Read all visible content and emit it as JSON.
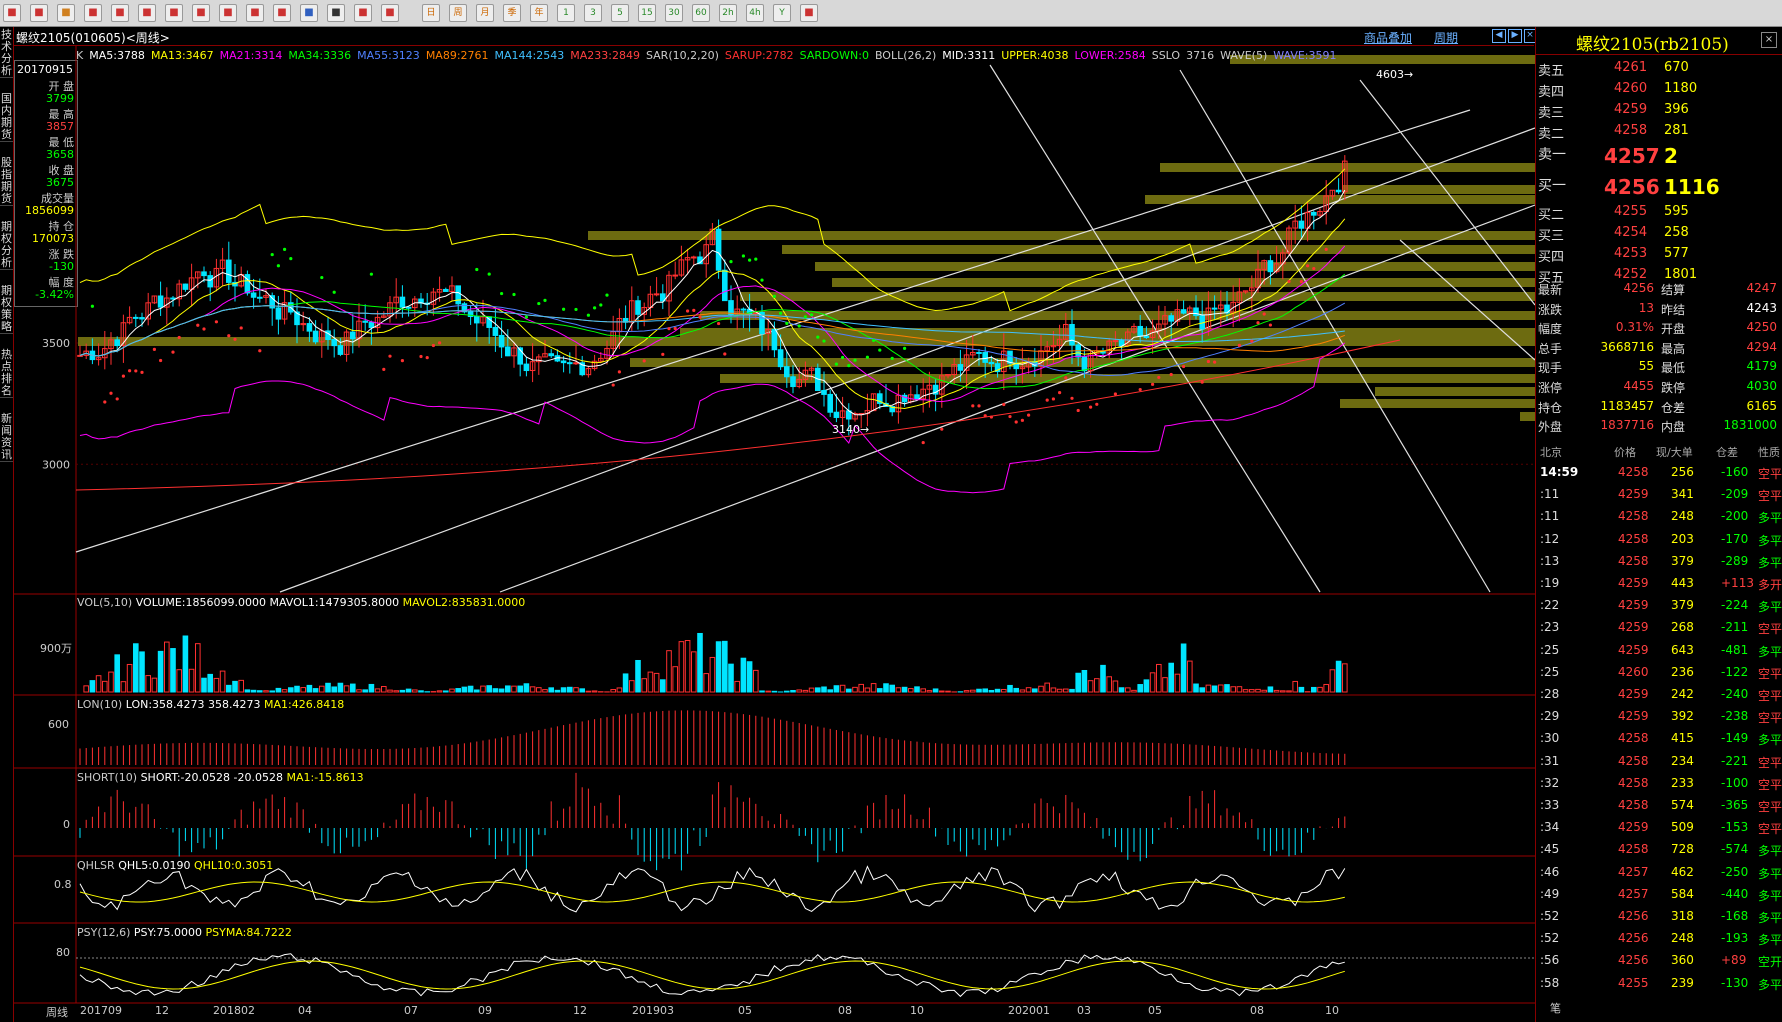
{
  "toolbar": {
    "icons": [
      "home-icon",
      "back-icon",
      "page-icon",
      "news-icon",
      "folder-icon",
      "search-icon",
      "search2-icon",
      "window-icon",
      "pen-icon",
      "draw-icon",
      "filter-icon",
      "edit-icon",
      "list-icon",
      "chart-icon",
      "kline-icon",
      "day-icon",
      "week-icon",
      "month-icon",
      "season-icon",
      "year-icon",
      "m1-icon",
      "m3-icon",
      "m5-icon",
      "m15-icon",
      "m30-icon",
      "m60-icon",
      "custom-icon",
      "calc-icon",
      "x-icon",
      "calendar-icon"
    ],
    "labels": [
      "",
      "",
      "",
      "",
      "",
      "",
      "",
      "",
      "",
      "",
      "",
      "",
      "",
      "",
      "",
      "日",
      "周",
      "月",
      "季",
      "年",
      "1",
      "3",
      "5",
      "15",
      "30",
      "60",
      "2h",
      "4h",
      "Y",
      ""
    ]
  },
  "title": {
    "contract": "螺纹2105(010605)<周线>",
    "overlay": "商品叠加",
    "period": "周期"
  },
  "left_tabs": [
    "技术分析",
    "国内期货",
    "股指期货",
    "期权分析",
    "期权策略",
    "热点排名",
    "新闻资讯"
  ],
  "ohlc": {
    "date": "20170915",
    "open_label": "开  盘",
    "open": "3799",
    "high_label": "最  高",
    "high": "3857",
    "low_label": "最  低",
    "low": "3658",
    "close_label": "收  盘",
    "close": "3675",
    "vol_label": "成交量",
    "vol": "1856099",
    "oi_label": "持  仓",
    "oi": "170073",
    "chg_label": "涨  跌",
    "chg": "-130",
    "pct_label": "幅  度",
    "pct": "-3.42%"
  },
  "main_indicators": [
    {
      "text": "K",
      "color": "#cccccc"
    },
    {
      "text": "MA5:3788",
      "color": "#ffffff"
    },
    {
      "text": "MA13:3467",
      "color": "#ffff00"
    },
    {
      "text": "MA21:3314",
      "color": "#ff00ff"
    },
    {
      "text": "MA34:3336",
      "color": "#00ff00"
    },
    {
      "text": "MA55:3123",
      "color": "#5080ff"
    },
    {
      "text": "MA89:2761",
      "color": "#ff8000"
    },
    {
      "text": "MA144:2543",
      "color": "#40c0ff"
    },
    {
      "text": "MA233:2849",
      "color": "#ff4040"
    },
    {
      "text": "SAR(10,2,20)",
      "color": "#cccccc"
    },
    {
      "text": "SARUP:2782",
      "color": "#ff3030"
    },
    {
      "text": "SARDOWN:0",
      "color": "#00ff00"
    },
    {
      "text": "BOLL(26,2)",
      "color": "#cccccc"
    },
    {
      "text": "MID:3311",
      "color": "#ffffff"
    },
    {
      "text": "UPPER:4038",
      "color": "#ffff00"
    },
    {
      "text": "LOWER:2584",
      "color": "#ff00ff"
    },
    {
      "text": "SSLO",
      "color": "#cccccc"
    },
    {
      "text": "3716",
      "color": "#cccccc"
    },
    {
      "text": "WAVE(5)",
      "color": "#cccccc"
    },
    {
      "text": "WAVE:3591",
      "color": "#8080ff"
    }
  ],
  "main_axis": [
    "3500",
    "3000"
  ],
  "annotations": {
    "high": "4603→",
    "low": "3140→"
  },
  "vol_panel": {
    "name": "VOL(5,10)",
    "t1": "VOLUME:1856099.0000",
    "t2": "MAVOL1:1479305.8000",
    "t3": "MAVOL2:835831.0000",
    "axis": "900万"
  },
  "lon_panel": {
    "name": "LON(10)",
    "t1": "LON:358.4273",
    "t2": "358.4273",
    "t3": "MA1:426.8418",
    "axis": "600"
  },
  "short_panel": {
    "name": "SHORT(10)",
    "t1": "SHORT:-20.0528",
    "t2": "-20.0528",
    "t3": "MA1:-15.8613",
    "axis": "0"
  },
  "qhlsr_panel": {
    "name": "QHLSR",
    "t1": "QHL5:0.0190",
    "t2": "QHL10:0.3051",
    "axis": "0.8"
  },
  "psy_panel": {
    "name": "PSY(12,6)",
    "t1": "PSY:75.0000",
    "t2": "PSYMA:84.7222",
    "axis": "80"
  },
  "x_axis": [
    "周线",
    "201709",
    "12",
    "201802",
    "04",
    "07",
    "09",
    "12",
    "201903",
    "05",
    "08",
    "10",
    "202001",
    "03",
    "05",
    "08",
    "10"
  ],
  "right": {
    "title": "螺纹2105(rb2105)",
    "asks": [
      {
        "l": "卖五",
        "p": "4261",
        "v": "670"
      },
      {
        "l": "卖四",
        "p": "4260",
        "v": "1180"
      },
      {
        "l": "卖三",
        "p": "4259",
        "v": "396"
      },
      {
        "l": "卖二",
        "p": "4258",
        "v": "281"
      },
      {
        "l": "卖一",
        "p": "4257",
        "v": "2"
      }
    ],
    "bids": [
      {
        "l": "买一",
        "p": "4256",
        "v": "1116"
      },
      {
        "l": "买二",
        "p": "4255",
        "v": "595"
      },
      {
        "l": "买三",
        "p": "4254",
        "v": "258"
      },
      {
        "l": "买四",
        "p": "4253",
        "v": "577"
      },
      {
        "l": "买五",
        "p": "4252",
        "v": "1801"
      }
    ],
    "stats": [
      {
        "a": "最新",
        "b": "4256",
        "c": "结算",
        "d": "4247",
        "bc": "#ff4040",
        "dc": "#ff4040"
      },
      {
        "a": "涨跌",
        "b": "13",
        "c": "昨结",
        "d": "4243",
        "bc": "#ff4040",
        "dc": "#ffffff"
      },
      {
        "a": "幅度",
        "b": "0.31%",
        "c": "开盘",
        "d": "4250",
        "bc": "#ff4040",
        "dc": "#ff4040"
      },
      {
        "a": "总手",
        "b": "3668716",
        "c": "最高",
        "d": "4294",
        "bc": "#ffff00",
        "dc": "#ff4040"
      },
      {
        "a": "现手",
        "b": "55",
        "c": "最低",
        "d": "4179",
        "bc": "#ffff00",
        "dc": "#00ff00"
      },
      {
        "a": "涨停",
        "b": "4455",
        "c": "跌停",
        "d": "4030",
        "bc": "#ff4040",
        "dc": "#00ff00"
      },
      {
        "a": "持仓",
        "b": "1183457",
        "c": "仓差",
        "d": "6165",
        "bc": "#ffff00",
        "dc": "#ffff00"
      },
      {
        "a": "外盘",
        "b": "1837716",
        "c": "内盘",
        "d": "1831000",
        "bc": "#ff4040",
        "dc": "#00ff00"
      }
    ],
    "tick_header": {
      "a": "北京",
      "b": "价格",
      "c": "现/大单",
      "d": "仓差",
      "e": "性质"
    },
    "ticks": [
      {
        "t": "14:59",
        "p": "4258",
        "v": "256",
        "d": "-160",
        "n": "空平",
        "nc": "#ff4040",
        "tc": "#ffffff"
      },
      {
        "t": ":11",
        "p": "4259",
        "v": "341",
        "d": "-209",
        "n": "空平",
        "nc": "#ff4040"
      },
      {
        "t": ":11",
        "p": "4258",
        "v": "248",
        "d": "-200",
        "n": "多平",
        "nc": "#00ff00"
      },
      {
        "t": ":12",
        "p": "4258",
        "v": "203",
        "d": "-170",
        "n": "多平",
        "nc": "#00ff00"
      },
      {
        "t": ":13",
        "p": "4258",
        "v": "379",
        "d": "-289",
        "n": "多平",
        "nc": "#00ff00"
      },
      {
        "t": ":19",
        "p": "4259",
        "v": "443",
        "d": "+113",
        "n": "多开",
        "nc": "#ff4040"
      },
      {
        "t": ":22",
        "p": "4259",
        "v": "379",
        "d": "-224",
        "n": "多平",
        "nc": "#00ff00"
      },
      {
        "t": ":23",
        "p": "4259",
        "v": "268",
        "d": "-211",
        "n": "空平",
        "nc": "#ff4040"
      },
      {
        "t": ":25",
        "p": "4259",
        "v": "643",
        "d": "-481",
        "n": "多平",
        "nc": "#00ff00"
      },
      {
        "t": ":25",
        "p": "4260",
        "v": "236",
        "d": "-122",
        "n": "空平",
        "nc": "#ff4040"
      },
      {
        "t": ":28",
        "p": "4259",
        "v": "242",
        "d": "-240",
        "n": "空平",
        "nc": "#ff4040"
      },
      {
        "t": ":29",
        "p": "4259",
        "v": "392",
        "d": "-238",
        "n": "空平",
        "nc": "#ff4040"
      },
      {
        "t": ":30",
        "p": "4258",
        "v": "415",
        "d": "-149",
        "n": "多平",
        "nc": "#00ff00"
      },
      {
        "t": ":31",
        "p": "4258",
        "v": "234",
        "d": "-221",
        "n": "空平",
        "nc": "#ff4040"
      },
      {
        "t": ":32",
        "p": "4258",
        "v": "233",
        "d": "-100",
        "n": "空平",
        "nc": "#ff4040"
      },
      {
        "t": ":33",
        "p": "4258",
        "v": "574",
        "d": "-365",
        "n": "空平",
        "nc": "#ff4040"
      },
      {
        "t": ":34",
        "p": "4259",
        "v": "509",
        "d": "-153",
        "n": "空平",
        "nc": "#ff4040"
      },
      {
        "t": ":45",
        "p": "4258",
        "v": "728",
        "d": "-574",
        "n": "多平",
        "nc": "#00ff00"
      },
      {
        "t": ":46",
        "p": "4257",
        "v": "462",
        "d": "-250",
        "n": "多平",
        "nc": "#00ff00"
      },
      {
        "t": ":49",
        "p": "4257",
        "v": "584",
        "d": "-440",
        "n": "多平",
        "nc": "#00ff00"
      },
      {
        "t": ":52",
        "p": "4256",
        "v": "318",
        "d": "-168",
        "n": "多平",
        "nc": "#00ff00"
      },
      {
        "t": ":52",
        "p": "4256",
        "v": "248",
        "d": "-193",
        "n": "多平",
        "nc": "#00ff00"
      },
      {
        "t": ":56",
        "p": "4256",
        "v": "360",
        "d": "+89",
        "n": "空开",
        "nc": "#00ff00"
      },
      {
        "t": ":58",
        "p": "4255",
        "v": "239",
        "d": "-130",
        "n": "多平",
        "nc": "#00ff00"
      }
    ],
    "footer": "笔"
  }
}
